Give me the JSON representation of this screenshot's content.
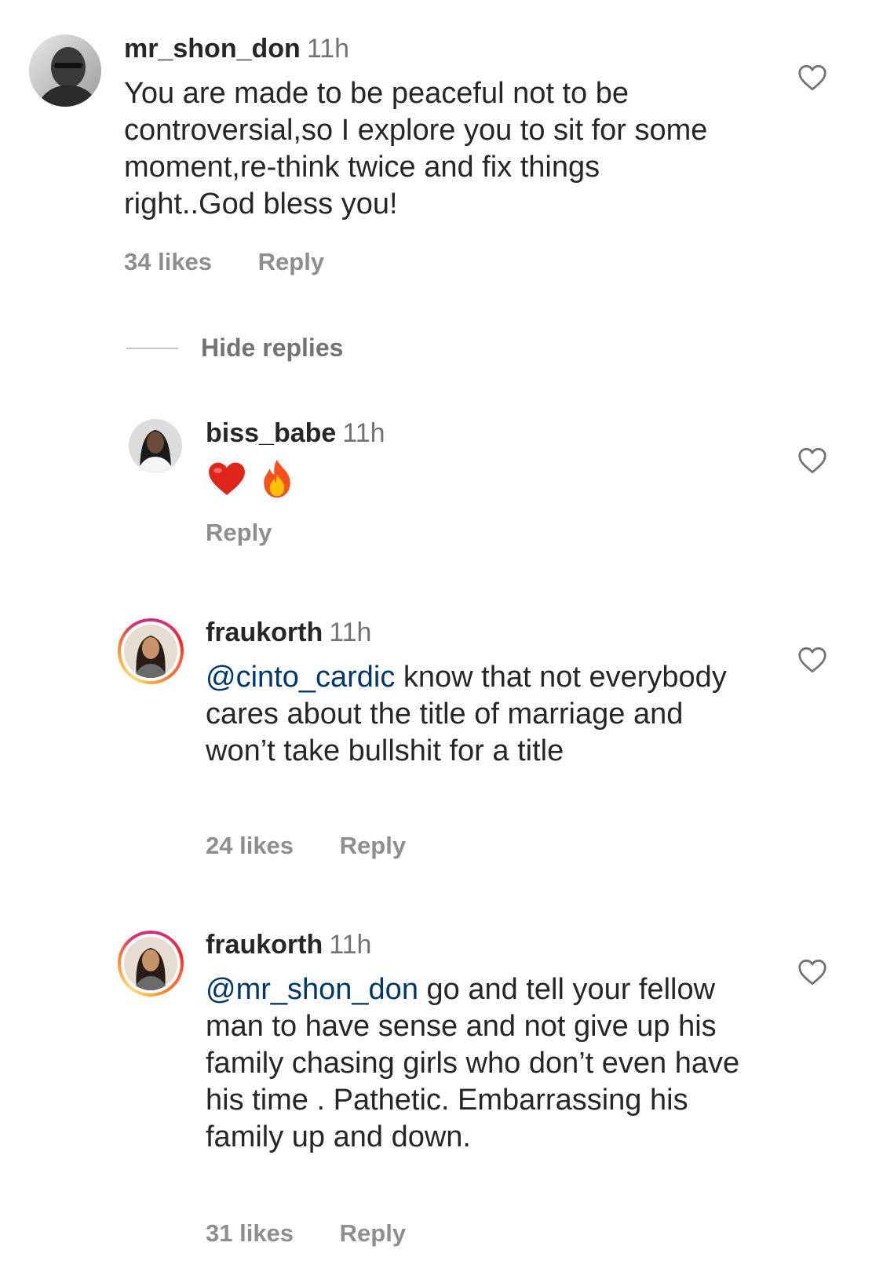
{
  "comments": [
    {
      "username": "mr_shon_don",
      "time": "11h",
      "text": "You are made to be peaceful not to be controversial,so I explore  you to sit for some moment,re-think twice and fix things right..God bless you!",
      "likes": "34 likes",
      "reply_label": "Reply"
    }
  ],
  "hide_replies_label": "Hide replies",
  "replies": [
    {
      "username": "biss_babe",
      "time": "11h",
      "emoji_names": [
        "red-heart",
        "fire"
      ],
      "reply_label": "Reply"
    },
    {
      "username": "fraukorth",
      "time": "11h",
      "mention": "@cinto_cardic",
      "text": " know that not everybody cares about the title of marriage and won’t take bullshit for a title",
      "likes": "24 likes",
      "reply_label": "Reply"
    },
    {
      "username": "fraukorth",
      "time": "11h",
      "mention": "@mr_shon_don",
      "text": " go and tell your fellow man to have sense and not give up his family chasing girls who don’t even have his time . Pathetic. Embarrassing his family up and down.",
      "likes": "31 likes",
      "reply_label": "Reply"
    }
  ],
  "colors": {
    "text": "#262626",
    "secondary": "#737373",
    "meta": "#8e8e8e",
    "mention": "#00376b",
    "story_ring": [
      "#c13584",
      "#e1306c",
      "#f77737",
      "#fcaf45"
    ]
  },
  "icons": {
    "like": "heart-outline-icon"
  }
}
